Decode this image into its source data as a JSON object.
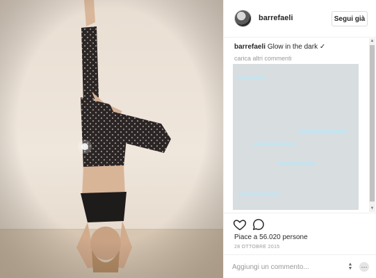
{
  "post": {
    "username": "barrefaeli",
    "follow_label": "Segui già",
    "caption_user": "barrefaeli",
    "caption_text": "Glow in the dark ✓",
    "load_more": "carica altri commenti",
    "likes": "Piace a 56.020 persone",
    "date": "28 OTTOBRE 2015",
    "comment_placeholder": "Aggiungi un commento...",
    "icons": {
      "like": "heart-icon",
      "comment": "comment-bubble-icon",
      "options": "more-options-icon",
      "spinner": "spin-arrows-icon"
    }
  },
  "colors": {
    "text": "#262626",
    "muted": "#999999",
    "border": "#efefef",
    "comment_overlay": "#d8dde0"
  }
}
